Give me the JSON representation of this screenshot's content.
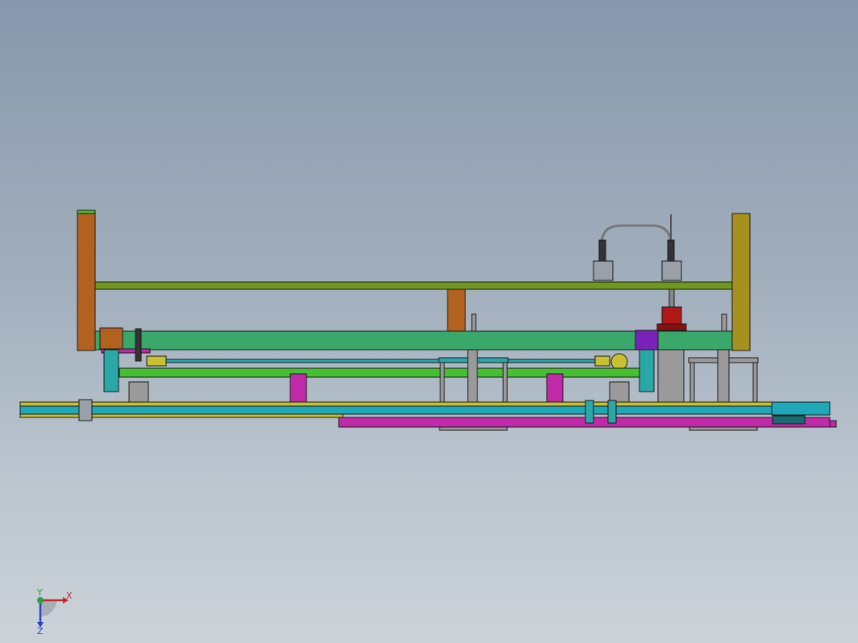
{
  "viewport": {
    "background_top": "#8898ac",
    "background_bottom": "#cbd3d8"
  },
  "colors": {
    "orange_post": "#b2621e",
    "olive_post": "#a8901e",
    "olive_rail": "#6f9a1e",
    "green_beam": "#3aa86a",
    "teal": "#2aa7a7",
    "magenta": "#c02aa8",
    "purple": "#7a22b8",
    "red_motor": "#b01818",
    "gray_part": "#9a9a9a",
    "yellow_stripe": "#c8c030",
    "cyan_base": "#1ea8b8",
    "bright_green": "#44c030"
  },
  "triad": {
    "x_label": "X",
    "y_label": "Y",
    "z_label": "Z",
    "x_color": "#c0282a",
    "y_color": "#2aa040",
    "z_color": "#2846c0"
  }
}
